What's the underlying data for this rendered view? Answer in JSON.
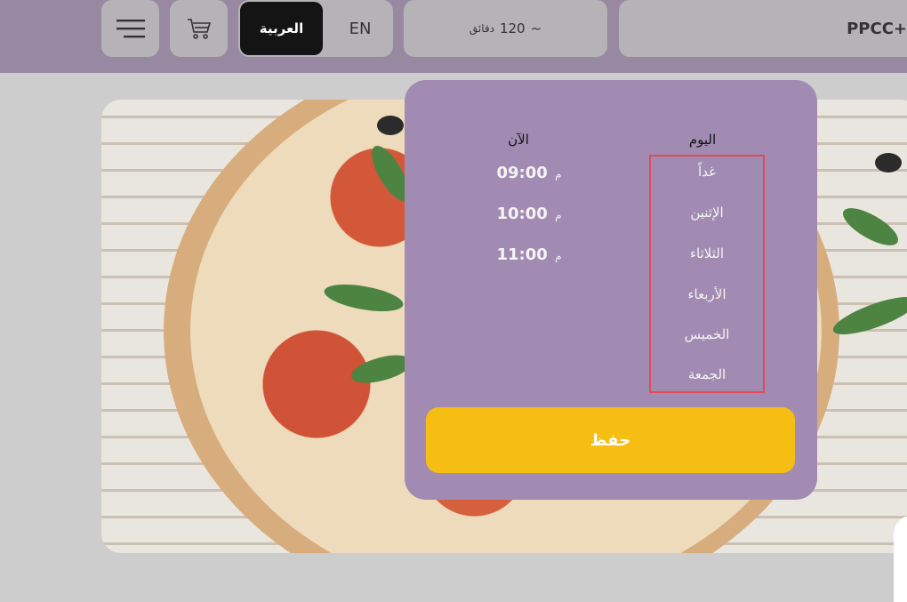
{
  "header": {
    "language_arabic": "العربية",
    "language_english": "EN",
    "delivery_time_value": "120",
    "delivery_time_unit": "دقائق",
    "delivery_time_prefix": "~",
    "phone_partial": "PPCC+",
    "icons": [
      "menu-icon",
      "cart-icon"
    ]
  },
  "schedule": {
    "day_header": "اليوم",
    "now_header": "الآن",
    "days": [
      "غداً",
      "الإثنين",
      "الثلاثاء",
      "الأربعاء",
      "الخميس",
      "الجمعة"
    ],
    "times": [
      {
        "value": "09:00",
        "unit": "م"
      },
      {
        "value": "10:00",
        "unit": "م"
      },
      {
        "value": "11:00",
        "unit": "م"
      }
    ],
    "save_label": "حفظ"
  },
  "colors": {
    "topbar": "#907e9b",
    "popup": "#a28bb2",
    "save": "#f6bd12",
    "highlight": "#e24a55",
    "active_language": "#000000"
  }
}
